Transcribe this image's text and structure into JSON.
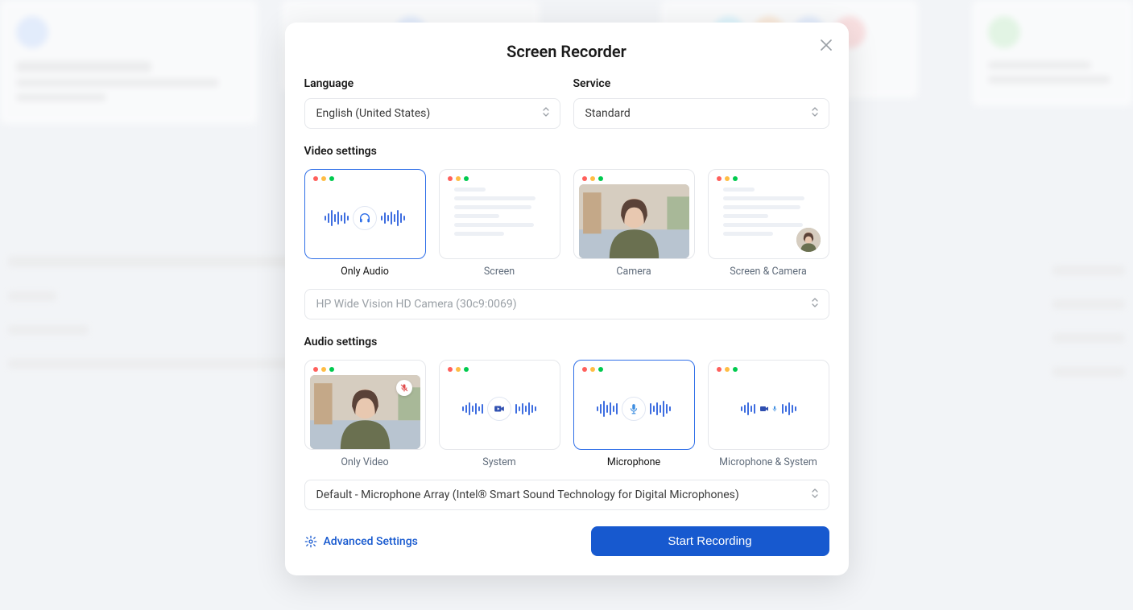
{
  "modal": {
    "title": "Screen Recorder",
    "language_label": "Language",
    "language_value": "English (United States)",
    "service_label": "Service",
    "service_value": "Standard",
    "video_settings_label": "Video settings",
    "video_options": {
      "only_audio": "Only Audio",
      "screen": "Screen",
      "camera": "Camera",
      "screen_camera": "Screen & Camera"
    },
    "camera_select": "HP Wide Vision HD Camera (30c9:0069)",
    "audio_settings_label": "Audio settings",
    "audio_options": {
      "only_video": "Only Video",
      "system": "System",
      "microphone": "Microphone",
      "mic_system": "Microphone & System"
    },
    "mic_select": "Default - Microphone Array (Intel® Smart Sound Technology for Digital Microphones)",
    "advanced_settings": "Advanced Settings",
    "start_button": "Start Recording"
  }
}
